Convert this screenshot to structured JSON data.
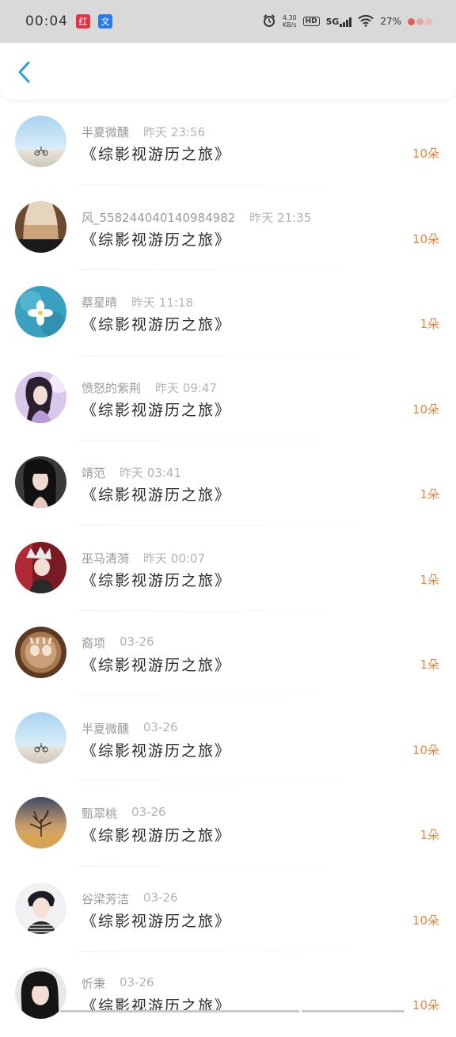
{
  "status_bar": {
    "time": "00:04",
    "app_icon_1": "红",
    "app_icon_2": "文",
    "net_speed_value": "4.30",
    "net_speed_unit": "KB/s",
    "hd": "HD",
    "network": "5G",
    "battery": "27%"
  },
  "header": {
    "back_icon": "chevron-left-icon"
  },
  "items": [
    {
      "name": "半夏微醺",
      "time": "昨天 23:56",
      "book": "《综影视游历之旅》",
      "count": "10朵"
    },
    {
      "name": "风_558244040140984982",
      "time": "昨天 21:35",
      "book": "《综影视游历之旅》",
      "count": "10朵"
    },
    {
      "name": "蔡星晴",
      "time": "昨天 11:18",
      "book": "《综影视游历之旅》",
      "count": "1朵"
    },
    {
      "name": "愤怒的紫荆",
      "time": "昨天 09:47",
      "book": "《综影视游历之旅》",
      "count": "10朵"
    },
    {
      "name": "靖范",
      "time": "昨天 03:41",
      "book": "《综影视游历之旅》",
      "count": "1朵"
    },
    {
      "name": "巫马清漪",
      "time": "昨天 00:07",
      "book": "《综影视游历之旅》",
      "count": "1朵"
    },
    {
      "name": "裔项",
      "time": "03-26",
      "book": "《综影视游历之旅》",
      "count": "1朵"
    },
    {
      "name": "半夏微醺",
      "time": "03-26",
      "book": "《综影视游历之旅》",
      "count": "10朵"
    },
    {
      "name": "甄翠桃",
      "time": "03-26",
      "book": "《综影视游历之旅》",
      "count": "1朵"
    },
    {
      "name": "谷梁芳洁",
      "time": "03-26",
      "book": "《综影视游历之旅》",
      "count": "10朵"
    },
    {
      "name": "忻秉",
      "time": "03-26",
      "book": "《综影视游历之旅》",
      "count": "10朵"
    }
  ],
  "colors": {
    "accent": "#e8863f",
    "back": "#2a9fd8",
    "status_bg": "#d9d9d9"
  }
}
